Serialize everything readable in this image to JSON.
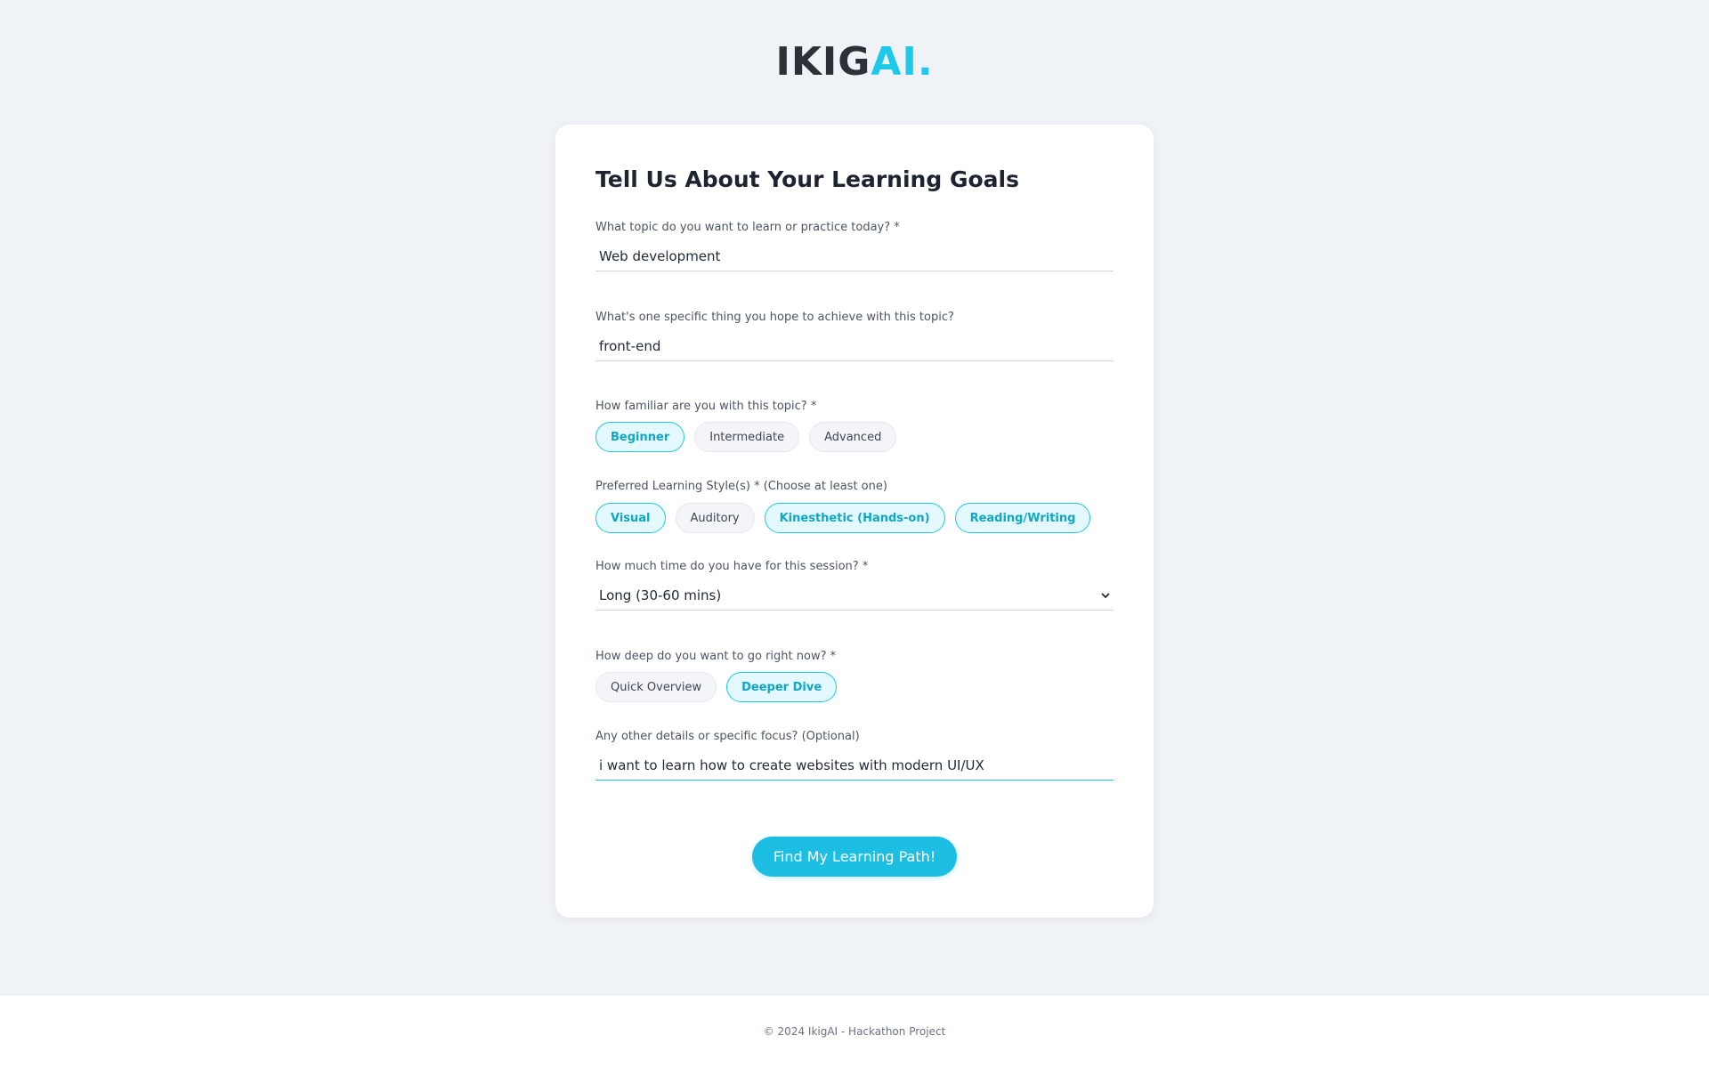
{
  "logo": {
    "part1": "IKIG",
    "part2": "AI."
  },
  "form": {
    "title": "Tell Us About Your Learning Goals",
    "topic": {
      "label": "What topic do you want to learn or practice today? *",
      "value": "Web development"
    },
    "goal": {
      "label": "What's one specific thing you hope to achieve with this topic?",
      "value": "front-end"
    },
    "familiarity": {
      "label": "How familiar are you with this topic? *",
      "options": [
        {
          "label": "Beginner",
          "selected": true
        },
        {
          "label": "Intermediate",
          "selected": false
        },
        {
          "label": "Advanced",
          "selected": false
        }
      ]
    },
    "learning_style": {
      "label": "Preferred Learning Style(s) * (Choose at least one)",
      "options": [
        {
          "label": "Visual",
          "selected": true
        },
        {
          "label": "Auditory",
          "selected": false
        },
        {
          "label": "Kinesthetic (Hands-on)",
          "selected": true
        },
        {
          "label": "Reading/Writing",
          "selected": true
        }
      ]
    },
    "time": {
      "label": "How much time do you have for this session? *",
      "selected_value": "Long (30-60 mins)",
      "icon": "chevron-down-icon"
    },
    "depth": {
      "label": "How deep do you want to go right now? *",
      "options": [
        {
          "label": "Quick Overview",
          "selected": false
        },
        {
          "label": "Deeper Dive",
          "selected": true
        }
      ]
    },
    "details": {
      "label": "Any other details or specific focus? (Optional)",
      "value": "i want to learn how to create websites with modern UI/UX"
    },
    "submit_label": "Find My Learning Path!"
  },
  "footer": {
    "text": "© 2024 IkigAI - Hackathon Project"
  },
  "colors": {
    "accent": "#1ec8e8",
    "button": "#1cbfe3",
    "background": "#eff2f7"
  }
}
